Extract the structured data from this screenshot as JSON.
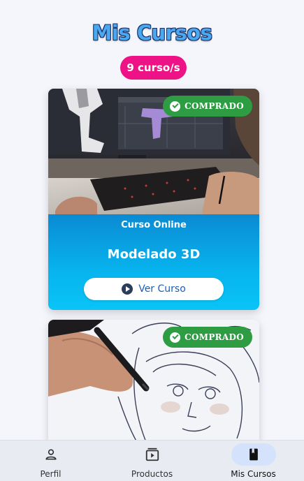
{
  "header": {
    "title": "Mis Cursos",
    "count_badge": "9 curso/s"
  },
  "courses": [
    {
      "badge": "COMPRADO",
      "type": "Curso Online",
      "name": "Modelado 3D",
      "button": "Ver Curso"
    },
    {
      "badge": "COMPRADO"
    }
  ],
  "bottom_nav": [
    {
      "label": "Perfil",
      "icon": "person-icon",
      "active": false
    },
    {
      "label": "Productos",
      "icon": "video-library-icon",
      "active": false
    },
    {
      "label": "Mis Cursos",
      "icon": "book-icon",
      "active": true
    }
  ],
  "colors": {
    "badge_pink": "#ee1287",
    "purchased_green": "#2e9c42",
    "card_gradient_top": "#0a8ad3",
    "card_gradient_bottom": "#09c4f6",
    "active_nav": "#d4e3fb"
  }
}
